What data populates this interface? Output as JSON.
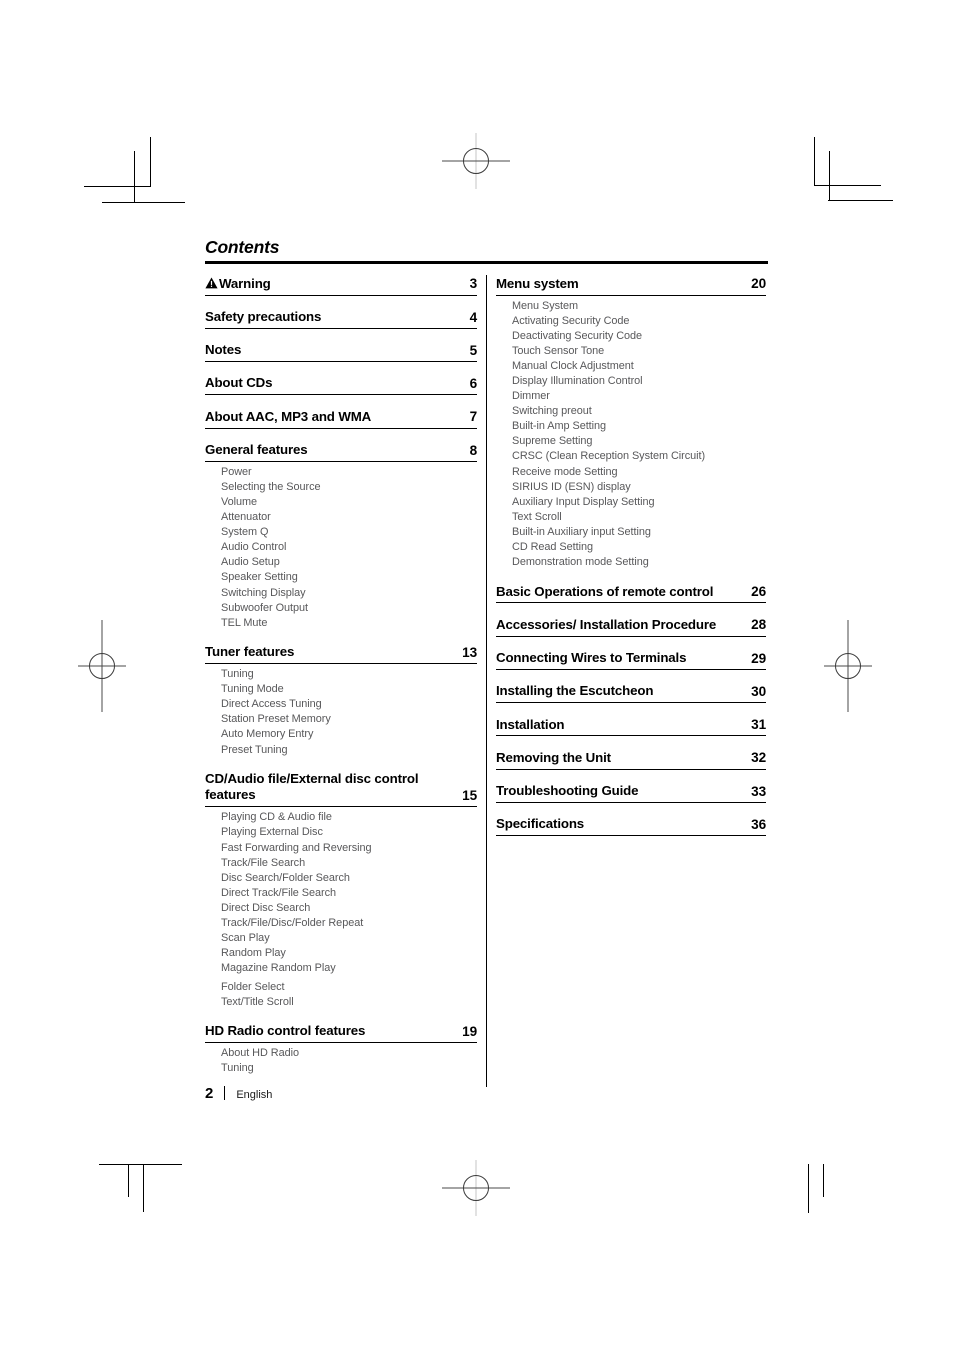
{
  "document": {
    "title": "Contents",
    "footer": {
      "page_number": "2",
      "language": "English"
    }
  },
  "left_column": [
    {
      "id": "warning",
      "label": "Warning",
      "icon": "warning-triangle-icon",
      "page": "3",
      "subitems": []
    },
    {
      "id": "safety-precautions",
      "label": "Safety precautions",
      "page": "4",
      "subitems": []
    },
    {
      "id": "notes",
      "label": "Notes",
      "page": "5",
      "subitems": []
    },
    {
      "id": "about-cds",
      "label": "About CDs",
      "page": "6",
      "subitems": []
    },
    {
      "id": "about-aac-mp3-wma",
      "label": "About AAC, MP3 and WMA",
      "page": "7",
      "subitems": []
    },
    {
      "id": "general-features",
      "label": "General features",
      "page": "8",
      "subitems": [
        "Power",
        "Selecting the Source",
        "Volume",
        "Attenuator",
        "System Q",
        "Audio Control",
        "Audio Setup",
        "Speaker Setting",
        "Switching Display",
        "Subwoofer Output",
        "TEL Mute"
      ]
    },
    {
      "id": "tuner-features",
      "label": "Tuner features",
      "page": "13",
      "subitems": [
        "Tuning",
        "Tuning Mode",
        "Direct Access Tuning",
        "Station Preset Memory",
        "Auto Memory Entry",
        "Preset Tuning"
      ]
    },
    {
      "id": "cd-audio-file-external-disc-control-features",
      "label": "CD/Audio file/External disc control features",
      "page": "15",
      "subitems": [
        "Playing CD & Audio file",
        "Playing External Disc",
        "Fast Forwarding and Reversing",
        "Track/File Search",
        "Disc Search/Folder Search",
        "Direct Track/File Search",
        "Direct Disc Search",
        "Track/File/Disc/Folder Repeat",
        "Scan Play",
        "Random Play",
        "Magazine Random Play",
        "Folder Select",
        "Text/Title Scroll"
      ],
      "subitem_gap_before_index": 11
    },
    {
      "id": "hd-radio-control-features",
      "label": "HD Radio control features",
      "page": "19",
      "subitems": [
        "About HD Radio",
        "Tuning"
      ]
    }
  ],
  "right_column": [
    {
      "id": "menu-system",
      "label": "Menu system",
      "page": "20",
      "subitems": [
        "Menu System",
        "Activating Security Code",
        "Deactivating Security Code",
        "Touch Sensor Tone",
        "Manual Clock Adjustment",
        "Display Illumination Control",
        "Dimmer",
        "Switching preout",
        "Built-in Amp Setting",
        "Supreme Setting",
        "CRSC (Clean Reception System Circuit)",
        "Receive mode Setting",
        "SIRIUS ID (ESN) display",
        "Auxiliary Input Display Setting",
        "Text Scroll",
        "Built-in Auxiliary input Setting",
        "CD Read Setting",
        "Demonstration mode Setting"
      ]
    },
    {
      "id": "basic-operations-of-remote-control",
      "label": "Basic Operations of remote control",
      "page": "26",
      "subitems": []
    },
    {
      "id": "accessories-installation-procedure",
      "label": "Accessories/ Installation Procedure",
      "page": "28",
      "subitems": []
    },
    {
      "id": "connecting-wires-to-terminals",
      "label": "Connecting Wires to Terminals",
      "page": "29",
      "subitems": []
    },
    {
      "id": "installing-the-escutcheon",
      "label": "Installing the Escutcheon",
      "page": "30",
      "subitems": []
    },
    {
      "id": "installation",
      "label": "Installation",
      "page": "31",
      "subitems": []
    },
    {
      "id": "removing-the-unit",
      "label": "Removing the Unit",
      "page": "32",
      "subitems": []
    },
    {
      "id": "troubleshooting-guide",
      "label": "Troubleshooting Guide",
      "page": "33",
      "subitems": []
    },
    {
      "id": "specifications",
      "label": "Specifications",
      "page": "36",
      "subitems": []
    }
  ],
  "colors": {
    "text": "#000000",
    "subitem_text": "#58585a",
    "rule": "#000000",
    "registration_mark": "#4a4a4a"
  }
}
